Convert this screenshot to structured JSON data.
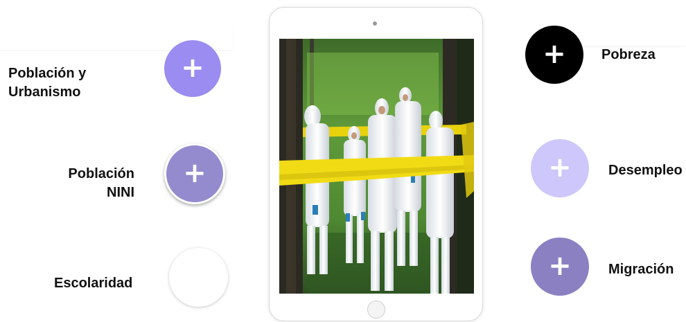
{
  "left": {
    "items": [
      {
        "label_line1": "Población y",
        "label_line2": "Urbanismo",
        "color": "#9a8cf0"
      },
      {
        "label_line1": "Población",
        "label_line2": "NINI",
        "color": "#938bce"
      },
      {
        "label_line1": "Escolaridad",
        "label_line2": "",
        "color": "#ffffff"
      }
    ]
  },
  "right": {
    "items": [
      {
        "label": "Pobreza",
        "color": "#000000"
      },
      {
        "label": "Desempleo",
        "color": "#cdc7fb"
      },
      {
        "label": "Migración",
        "color": "#8a80c2"
      }
    ]
  },
  "icons": {
    "plus": "+"
  },
  "tablet": {
    "photo": "forensic team in white protective suits behind yellow crime-scene tape in a forest"
  }
}
